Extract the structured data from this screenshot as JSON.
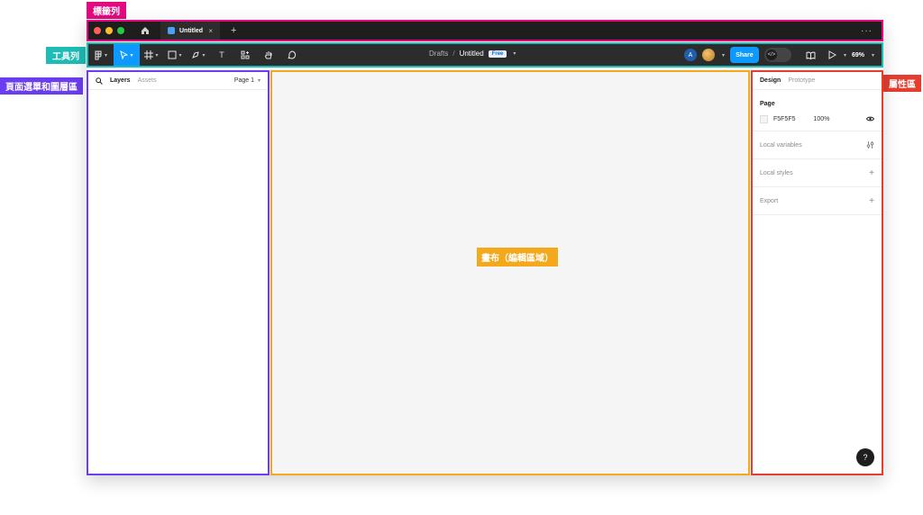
{
  "annotations": {
    "title_bar": "標籤列",
    "toolbar": "工具列",
    "layers_area": "頁面選單和圖層區",
    "properties": "屬性區",
    "canvas": "畫布（編輯區域）"
  },
  "tabbar": {
    "tab_label": "Untitled",
    "close": "×",
    "add": "+",
    "more": "···"
  },
  "toolbar": {
    "breadcrumb_root": "Drafts",
    "separator": "/",
    "file_title": "Untitled",
    "plan_badge": "Free",
    "avatar_initial": "A",
    "share_label": "Share",
    "zoom": "69%",
    "text_tool": "T"
  },
  "left_panel": {
    "tabs": [
      {
        "label": "Layers"
      },
      {
        "label": "Assets"
      }
    ],
    "page_selector": "Page 1"
  },
  "right_panel": {
    "tabs": [
      {
        "label": "Design"
      },
      {
        "label": "Prototype"
      }
    ],
    "page_section_title": "Page",
    "page_color": "F5F5F5",
    "page_opacity": "100%",
    "rows": [
      {
        "label": "Local variables"
      },
      {
        "label": "Local styles"
      },
      {
        "label": "Export"
      }
    ],
    "help": "?"
  },
  "colors": {
    "accent": "#0d99ff",
    "tabbar_bg": "#1e1e1e",
    "toolbar_bg": "#2c2c2c",
    "canvas_bg": "#f5f5f5"
  }
}
